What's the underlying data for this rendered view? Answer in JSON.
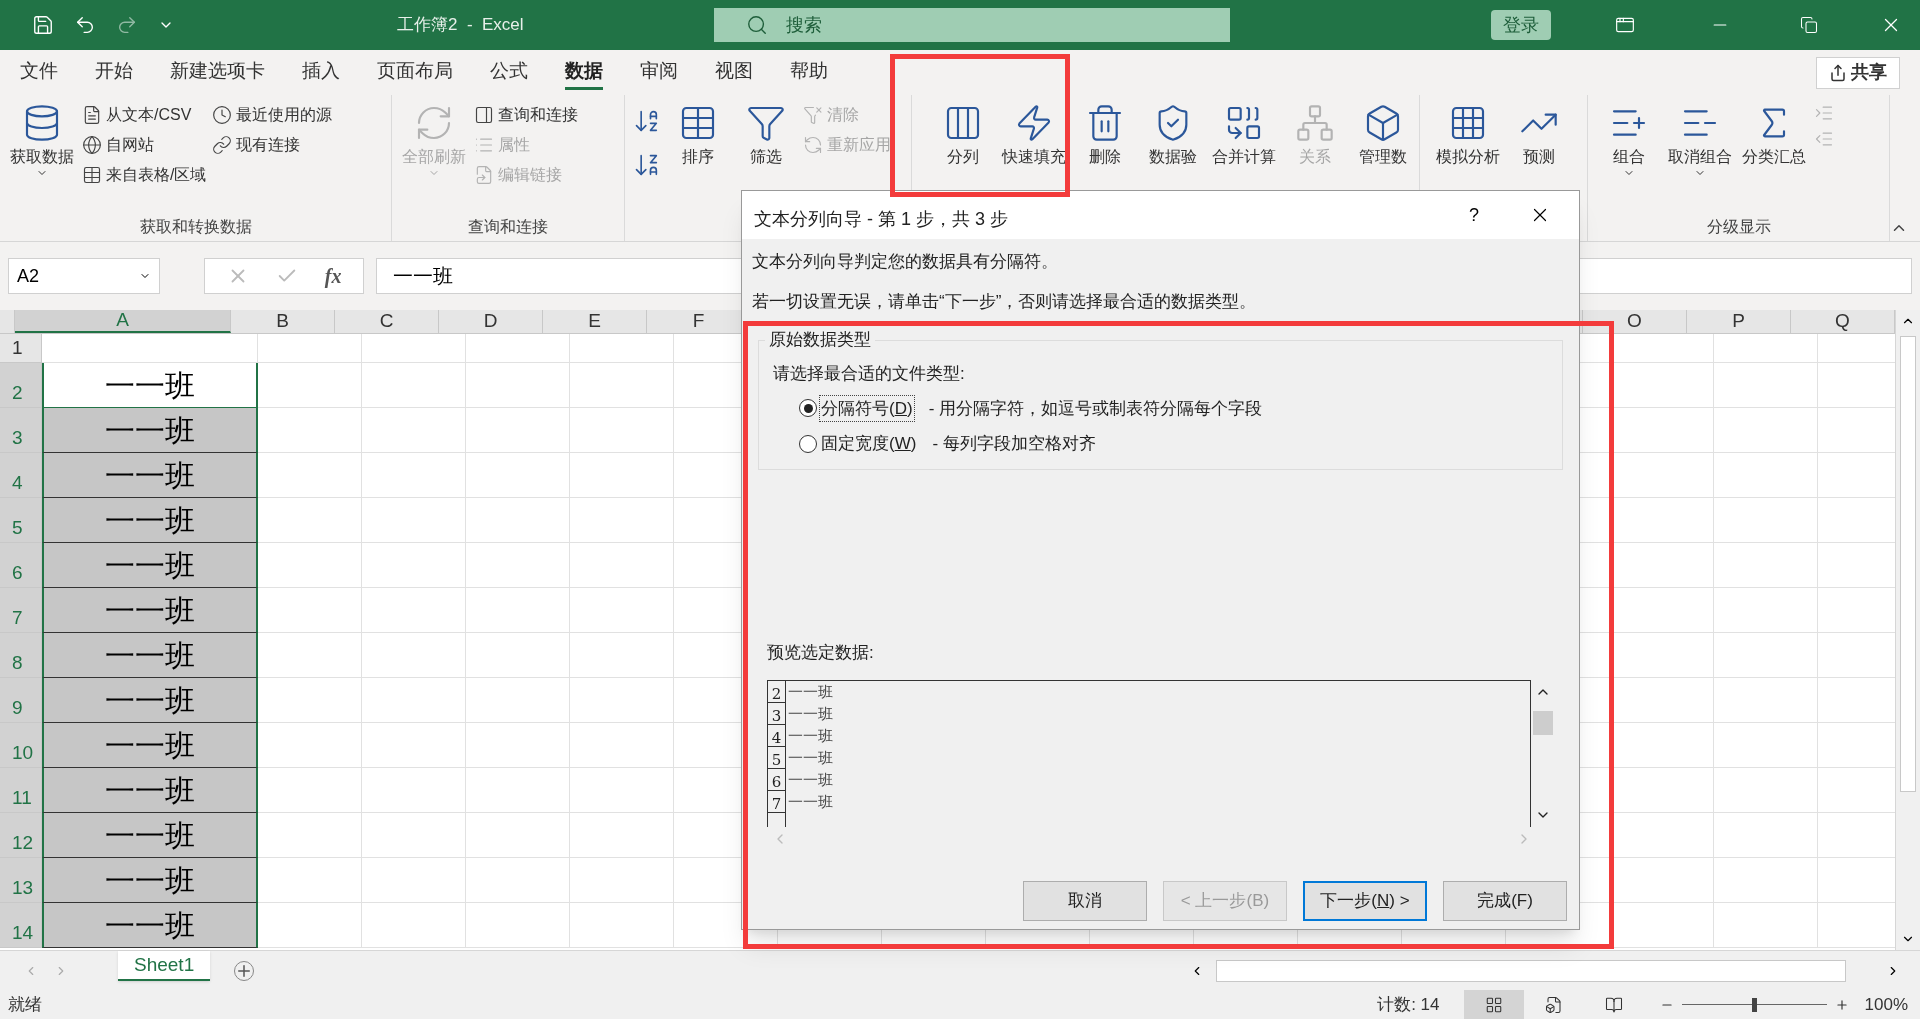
{
  "title_bar": {
    "title": "工作簿2  -  Excel",
    "search": {
      "placeholder": "搜索"
    },
    "sign_in": "登录"
  },
  "tabs": [
    {
      "label": "文件",
      "selected": false
    },
    {
      "label": "开始",
      "selected": false
    },
    {
      "label": "新建选项卡",
      "selected": false
    },
    {
      "label": "插入",
      "selected": false
    },
    {
      "label": "页面布局",
      "selected": false
    },
    {
      "label": "公式",
      "selected": false
    },
    {
      "label": "数据",
      "selected": true
    },
    {
      "label": "审阅",
      "selected": false
    },
    {
      "label": "视图",
      "selected": false
    },
    {
      "label": "帮助",
      "selected": false
    }
  ],
  "share": "共享",
  "ribbon": [
    {
      "label": "获取和转换数据",
      "items": [
        {
          "kind": "large",
          "label": "获取数据",
          "dropdown": true,
          "disabled": false
        },
        {
          "kind": "stack",
          "items": [
            {
              "label": "从文本/CSV",
              "disabled": false
            },
            {
              "label": "自网站",
              "disabled": false
            },
            {
              "label": "来自表格/区域",
              "disabled": false
            }
          ]
        },
        {
          "kind": "stack",
          "items": [
            {
              "label": "最近使用的源",
              "disabled": false
            },
            {
              "label": "现有连接",
              "disabled": false
            }
          ]
        }
      ]
    },
    {
      "label": "查询和连接",
      "items": [
        {
          "kind": "large",
          "label": "全部刷新",
          "dropdown": true,
          "disabled": true
        },
        {
          "kind": "stack",
          "items": [
            {
              "label": "查询和连接",
              "disabled": false
            },
            {
              "label": "属性",
              "disabled": true
            },
            {
              "label": "编辑链接",
              "disabled": true
            }
          ]
        }
      ]
    },
    {
      "items": [
        {
          "kind": "sort"
        },
        {
          "kind": "large",
          "label": "排序",
          "dropdown": false,
          "disabled": false
        },
        {
          "kind": "large",
          "label": "筛选",
          "dropdown": false,
          "disabled": false
        },
        {
          "kind": "stack",
          "items": [
            {
              "label": "清除",
              "disabled": true
            },
            {
              "label": "重新应用",
              "disabled": true
            }
          ]
        }
      ]
    },
    {
      "items": [
        {
          "kind": "large",
          "label": "分列",
          "dropdown": false,
          "disabled": false
        },
        {
          "kind": "large",
          "label": "快速填充",
          "dropdown": false,
          "disabled": false
        },
        {
          "kind": "large",
          "label": "删除",
          "dropdown": false,
          "disabled": false
        },
        {
          "kind": "large",
          "label": "数据验",
          "dropdown": false,
          "disabled": false
        },
        {
          "kind": "large",
          "label": "合并计算",
          "dropdown": false,
          "disabled": false
        },
        {
          "kind": "large",
          "label": "关系",
          "dropdown": false,
          "disabled": true
        },
        {
          "kind": "large",
          "label": "管理数",
          "dropdown": false,
          "disabled": false
        }
      ]
    },
    {
      "items": [
        {
          "kind": "large",
          "label": "模拟分析",
          "dropdown": false,
          "disabled": false
        },
        {
          "kind": "large",
          "label": "预测",
          "dropdown": false,
          "disabled": false
        }
      ]
    },
    {
      "label": "分级显示",
      "items": [
        {
          "kind": "large",
          "label": "组合",
          "dropdown": true,
          "disabled": false
        },
        {
          "kind": "large",
          "label": "取消组合",
          "dropdown": true,
          "disabled": false
        },
        {
          "kind": "large",
          "label": "分类汇总",
          "dropdown": false,
          "disabled": false
        },
        {
          "kind": "stack",
          "items": [
            {
              "disabled": true
            },
            {
              "disabled": true
            }
          ]
        }
      ]
    }
  ],
  "formula_bar": {
    "name_box": "A2",
    "fx": "fx",
    "value": "一一班"
  },
  "columns_left": [
    {
      "label": "A",
      "selected": true
    },
    {
      "label": "B",
      "selected": false
    },
    {
      "label": "C",
      "selected": false
    },
    {
      "label": "D",
      "selected": false
    },
    {
      "label": "E",
      "selected": false
    },
    {
      "label": "F",
      "selected": false
    }
  ],
  "columns_right": [
    {
      "label": "O",
      "selected": false
    },
    {
      "label": "P",
      "selected": false
    },
    {
      "label": "Q",
      "selected": false
    }
  ],
  "rows": [
    {
      "number": "1",
      "selected": false
    },
    {
      "number": "2",
      "cell": {
        "text": "一一班",
        "active": true
      },
      "selected": true
    },
    {
      "number": "3",
      "cell": {
        "text": "一一班",
        "active": false
      },
      "selected": true
    },
    {
      "number": "4",
      "cell": {
        "text": "一一班",
        "active": false
      },
      "selected": true
    },
    {
      "number": "5",
      "cell": {
        "text": "一一班",
        "active": false
      },
      "selected": true
    },
    {
      "number": "6",
      "cell": {
        "text": "一一班",
        "active": false
      },
      "selected": true
    },
    {
      "number": "7",
      "cell": {
        "text": "一一班",
        "active": false
      },
      "selected": true
    },
    {
      "number": "8",
      "cell": {
        "text": "一一班",
        "active": false
      },
      "selected": true
    },
    {
      "number": "9",
      "cell": {
        "text": "一一班",
        "active": false
      },
      "selected": true
    },
    {
      "number": "10",
      "cell": {
        "text": "一一班",
        "active": false
      },
      "selected": true
    },
    {
      "number": "11",
      "cell": {
        "text": "一一班",
        "active": false
      },
      "selected": true
    },
    {
      "number": "12",
      "cell": {
        "text": "一一班",
        "active": false
      },
      "selected": true
    },
    {
      "number": "13",
      "cell": {
        "text": "一一班",
        "active": false
      },
      "selected": true
    },
    {
      "number": "14",
      "cell": {
        "text": "一一班",
        "active": false
      },
      "selected": true
    }
  ],
  "sheet_tabs": [
    {
      "label": "Sheet1",
      "selected": true
    }
  ],
  "status_bar": {
    "status": "就绪",
    "count": "计数: 14",
    "views": [
      {
        "selected": true
      },
      {
        "selected": false
      },
      {
        "selected": false
      }
    ],
    "zoom": {
      "level": 0.5
    },
    "zoom_reading": "100%"
  },
  "dialog": {
    "title": "文本分列向导 - 第 1 步，共 3 步",
    "help": "?",
    "lines": [
      "文本分列向导判定您的数据具有分隔符。",
      "若一切设置无误，请单击“下一步”，否则请选择最合适的数据类型。"
    ],
    "group_title": "原始数据类型",
    "prompt": "请选择最合适的文件类型:",
    "options": [
      {
        "label_parts": [
          "分隔符号(",
          "D",
          ")"
        ],
        "description": "- 用分隔字符，如逗号或制表符分隔每个字段",
        "selected": true
      },
      {
        "label_parts": [
          "固定宽度(",
          "W",
          ")"
        ],
        "description": "- 每列字段加空格对齐",
        "selected": false
      }
    ],
    "preview_label": "预览选定数据:",
    "preview_rows": [
      {
        "number": "2",
        "text": "一一班"
      },
      {
        "number": "3",
        "text": "一一班"
      },
      {
        "number": "4",
        "text": "一一班"
      },
      {
        "number": "5",
        "text": "一一班"
      },
      {
        "number": "6",
        "text": "一一班"
      },
      {
        "number": "7",
        "text": "一一班"
      }
    ],
    "buttons": [
      {
        "label_parts": [
          "取消"
        ],
        "disabled": false,
        "default": false
      },
      {
        "label_parts": [
          "< 上一步(B)"
        ],
        "disabled": true,
        "default": false
      },
      {
        "label_parts": [
          "下一步(",
          "N",
          ") >"
        ],
        "disabled": false,
        "default": true
      },
      {
        "label_parts": [
          "完成(F)"
        ],
        "disabled": false,
        "default": false
      }
    ]
  }
}
